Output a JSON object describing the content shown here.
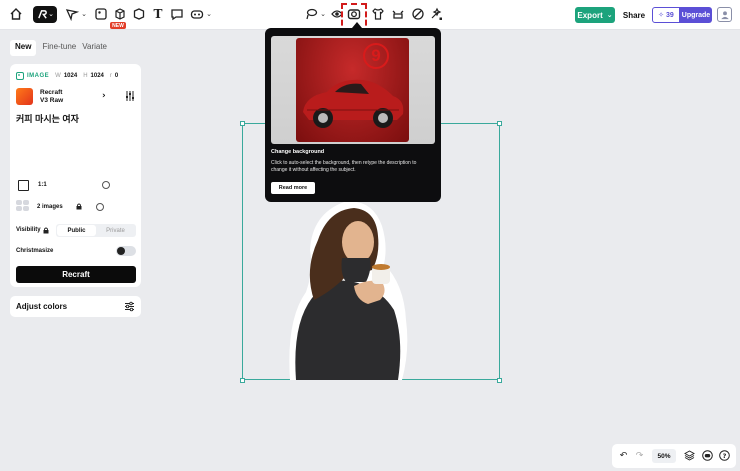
{
  "toolbar": {
    "new_badge": "NEW",
    "export_label": "Export",
    "share_label": "Share",
    "credits": "39",
    "upgrade_label": "Upgrade"
  },
  "tabs": [
    "New",
    "Fine-tune",
    "Variate"
  ],
  "panel": {
    "image_label": "IMAGE",
    "width_label": "W",
    "width_value": "1024",
    "height_label": "H",
    "height_value": "1024",
    "extra_label": "r",
    "extra_value": "0",
    "model_name": "Recraft",
    "model_version": "V3 Raw",
    "prompt": "커피 마시는 여자",
    "ratio": "1:1",
    "images_count": "2 images",
    "visibility_label": "Visibility",
    "visibility_options": [
      "Public",
      "Private"
    ],
    "christmasize_label": "Christmasize",
    "recraft_button": "Recraft"
  },
  "adjust_colors": "Adjust colors",
  "tooltip": {
    "step_number": "9",
    "title": "Change background",
    "description": "Click to auto-select the background, then retype the description to change it without affecting the subject.",
    "button": "Read more"
  },
  "zoom": "50%",
  "colors": {
    "accent_green": "#1ca37c",
    "upgrade_purple": "#5b4fd6",
    "selection_teal": "#3aa99c",
    "highlight_red": "#d21b1b"
  }
}
